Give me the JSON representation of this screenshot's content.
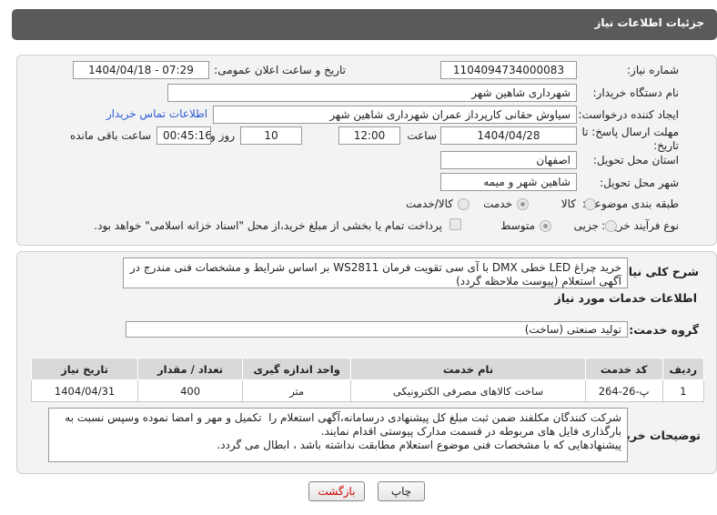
{
  "header": {
    "title": "جزئیات اطلاعات نیاز"
  },
  "form": {
    "need_number_label": "شماره نیاز:",
    "need_number": "1104094734000083",
    "announce_label": "تاریخ و ساعت اعلان عمومی:",
    "announce_value": "1404/04/18 - 07:29",
    "buyer_org_label": "نام دستگاه خریدار:",
    "buyer_org": "شهرداری شاهین شهر",
    "creator_label": "ایجاد کننده درخواست:",
    "creator": "سیاوش حقانی کارپرداز عمران شهرداری شاهین شهر",
    "contact_link": "اطلاعات تماس خریدار",
    "deadline_label_1": "مهلت ارسال پاسخ: تا",
    "deadline_label_2": "تاریخ:",
    "deadline_date": "1404/04/28",
    "time_label": "ساعت",
    "deadline_time": "12:00",
    "days": "10",
    "days_label": "روز و",
    "remaining": "00:45:16",
    "remaining_label": "ساعت باقی مانده",
    "province_label": "استان محل تحویل:",
    "province": "اصفهان",
    "city_label": "شهر محل تحویل:",
    "city": "شاهین شهر و میمه",
    "category_label": "طبقه بندی موضوعی:",
    "category_options": [
      "کالا",
      "خدمت",
      "کالا/خدمت"
    ],
    "category_selected": "خدمت",
    "process_label": "نوع فرآیند خرید :",
    "process_options": [
      "جزیی",
      "متوسط"
    ],
    "process_selected": "متوسط",
    "treasury_note": "پرداخت تمام یا بخشی از مبلغ خرید،از محل \"اسناد خزانه اسلامی\" خواهد بود."
  },
  "summary": {
    "label": "شرح کلی نیاز:",
    "text": "خرید چراغ LED خطی DMX با آی سی تقویت فرمان WS2811 بر اساس شرایط و مشخصات فنی مندرج در آگهی استعلام (پیوست ملاحظه گردد)"
  },
  "services": {
    "section_title": "اطلاعات خدمات مورد نیاز",
    "group_label": "گروه خدمت:",
    "group_value": "تولید صنعتی (ساخت)",
    "columns": [
      "ردیف",
      "کد خدمت",
      "نام خدمت",
      "واحد اندازه گیری",
      "تعداد / مقدار",
      "تاریخ نیاز"
    ],
    "rows": [
      [
        "1",
        "پ-26-264",
        "ساخت کالاهای مصرفی الکترونیکی",
        "متر",
        "400",
        "1404/04/31"
      ]
    ]
  },
  "buyer_notes": {
    "label": "توضیحات خریدار:",
    "text": "شرکت کنندگان مکلفند ضمن ثبت مبلغ کل پیشنهادی درسامانه،آگهی استعلام را  تکمیل و مهر و امضا نموده وسپس نسبت به بارگذاری فایل های مربوطه در قسمت مدارک پیوستی اقدام نمایند.\nپیشنهادهایی که با مشخصات فنی موضوع استعلام مطابقت نداشته باشد ، ابطال می گردد."
  },
  "buttons": {
    "print": "چاپ",
    "back": "بازگشت"
  },
  "colors": {
    "header_bg": "#5a5a5a",
    "link": "#2a5bd7",
    "back_button_text": "#cc0000",
    "watermark": "#c0392b"
  }
}
